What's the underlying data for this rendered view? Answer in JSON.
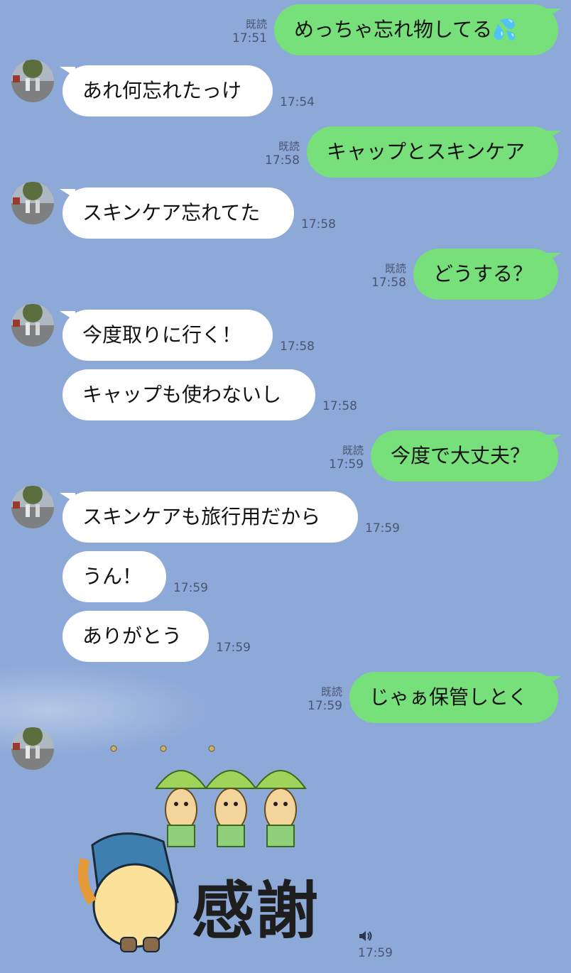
{
  "colors": {
    "background": "#8da9d8",
    "outgoing_bubble": "#77e07a",
    "incoming_bubble": "#ffffff",
    "meta_text": "#4a5570"
  },
  "messages": [
    {
      "side": "out",
      "text": "めっちゃ忘れ物してる💦",
      "read": "既読",
      "time": "17:51"
    },
    {
      "side": "in",
      "text": "あれ何忘れたっけ",
      "time": "17:54",
      "avatar": true
    },
    {
      "side": "out",
      "text": "キャップとスキンケア",
      "read": "既読",
      "time": "17:58"
    },
    {
      "side": "in",
      "text": "スキンケア忘れてた",
      "time": "17:58",
      "avatar": true
    },
    {
      "side": "out",
      "text": "どうする？",
      "read": "既読",
      "time": "17:58"
    },
    {
      "side": "in",
      "text": "今度取りに行く！",
      "time": "17:58",
      "avatar": true
    },
    {
      "side": "in",
      "text": "キャップも使わないし",
      "time": "17:58"
    },
    {
      "side": "out",
      "text": "今度で大丈夫？",
      "read": "既読",
      "time": "17:59"
    },
    {
      "side": "in",
      "text": "スキンケアも旅行用だから",
      "time": "17:59",
      "avatar": true
    },
    {
      "side": "in",
      "text": "うん！",
      "time": "17:59"
    },
    {
      "side": "in",
      "text": "ありがとう",
      "time": "17:59"
    },
    {
      "side": "out",
      "text": "じゃぁ保管しとく",
      "read": "既読",
      "time": "17:59"
    }
  ],
  "sticker": {
    "text": "感謝",
    "time": "17:59",
    "icon": "speaker-icon"
  }
}
